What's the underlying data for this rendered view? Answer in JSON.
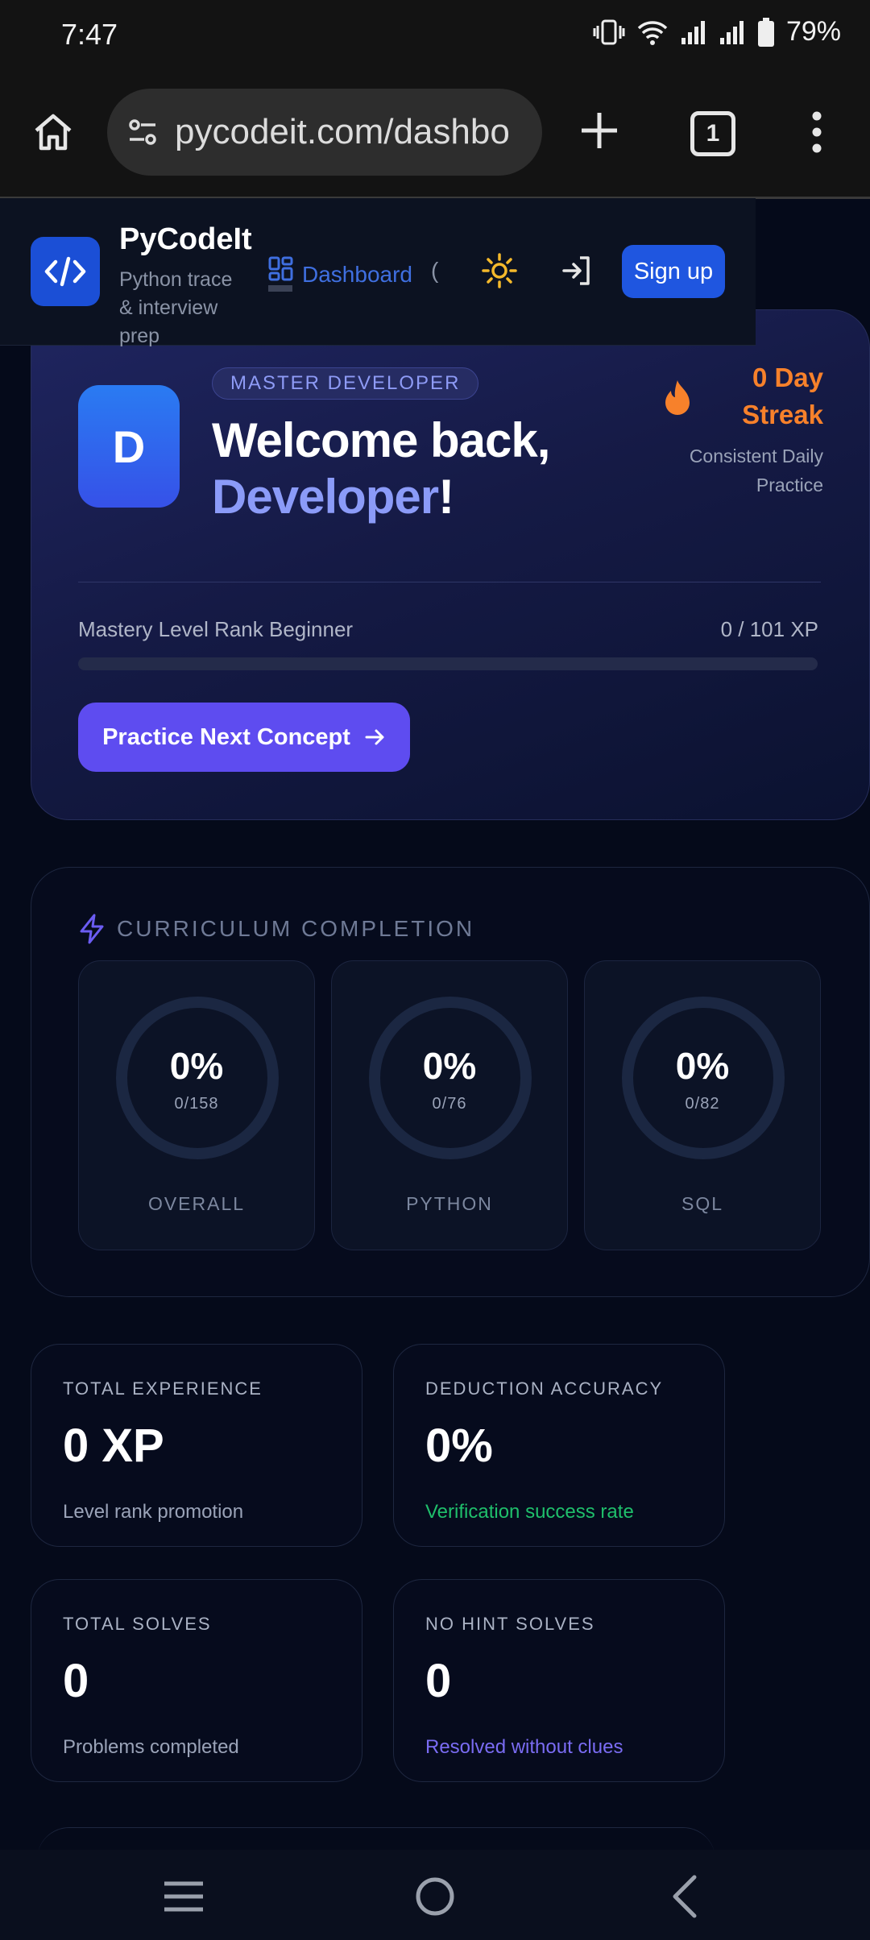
{
  "status_bar": {
    "time": "7:47",
    "battery": "79%"
  },
  "browser": {
    "url": "pycodeit.com/dashbo",
    "tab_count": "1"
  },
  "site_header": {
    "brand": "PyCodeIt",
    "tagline": "Python trace & interview prep",
    "nav_dashboard": "Dashboard",
    "nav_partial": "(",
    "signup_label": "Sign up"
  },
  "hero": {
    "avatar_initial": "D",
    "badge": "MASTER DEVELOPER",
    "welcome_line": "Welcome back,",
    "user_name": "Developer",
    "exclaim": "!",
    "streak": "0 Day Streak",
    "streak_sub": "Consistent Daily Practice",
    "mastery_label": "Mastery Level Rank Beginner",
    "xp_text": "0 / 101 XP",
    "progress": 0,
    "practice_button": "Practice Next Concept"
  },
  "curriculum": {
    "title": "CURRICULUM COMPLETION",
    "rings": [
      {
        "percent": "0%",
        "count": "0/158",
        "label": "OVERALL"
      },
      {
        "percent": "0%",
        "count": "0/76",
        "label": "PYTHON"
      },
      {
        "percent": "0%",
        "count": "0/82",
        "label": "SQL"
      }
    ]
  },
  "stats": [
    {
      "label": "TOTAL EXPERIENCE",
      "value": "0 XP",
      "sub": "Level rank promotion",
      "sub_color": "#9aa3b8"
    },
    {
      "label": "DEDUCTION ACCURACY",
      "value": "0%",
      "sub": "Verification success rate",
      "sub_color": "#1fbf6b"
    },
    {
      "label": "TOTAL SOLVES",
      "value": "0",
      "sub": "Problems completed",
      "sub_color": "#9aa3b8"
    },
    {
      "label": "NO HINT SOLVES",
      "value": "0",
      "sub": "Resolved without clues",
      "sub_color": "#7a6cf3"
    }
  ],
  "colors": {
    "accent": "#5e4cf0",
    "streak": "#f7812b",
    "brand_blue": "#1f56e0"
  }
}
